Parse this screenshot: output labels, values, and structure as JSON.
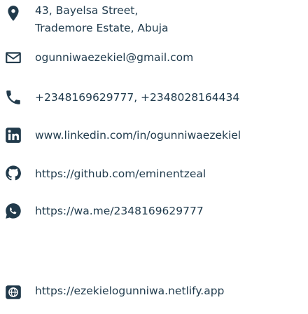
{
  "contact": {
    "address": {
      "line1": "43, Bayelsa Street,",
      "line2": "Trademore Estate, Abuja",
      "icon": "location-pin-icon"
    },
    "email": {
      "text": "ogunniwaezekiel@gmail.com",
      "icon": "envelope-icon"
    },
    "phone": {
      "text": "+2348169629777, +2348028164434",
      "icon": "phone-icon"
    },
    "linkedin": {
      "text": "www.linkedin.com/in/ogunniwaezekiel",
      "icon": "linkedin-icon"
    },
    "github": {
      "text": "https://github.com/eminentzeal",
      "icon": "github-icon"
    },
    "whatsapp": {
      "text": "https://wa.me/2348169629777",
      "icon": "whatsapp-icon"
    },
    "website": {
      "text": "https://ezekielogunniwa.netlify.app",
      "icon": "website-icon"
    }
  },
  "colors": {
    "icon": "#213a4b",
    "text": "#1f3a4c",
    "background": "#ffffff"
  }
}
